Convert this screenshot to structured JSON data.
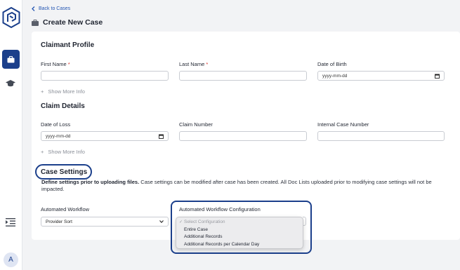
{
  "nav": {
    "back_label": "Back to Cases",
    "page_title": "Create New Case",
    "avatar_initial": "A"
  },
  "claimant": {
    "title": "Claimant Profile",
    "first_name_label": "First Name",
    "last_name_label": "Last Name",
    "dob_label": "Date of Birth",
    "dob_value": "yyyy-mm-dd",
    "required_mark": "*",
    "show_more": "Show More Info"
  },
  "claim": {
    "title": "Claim Details",
    "date_of_loss_label": "Date of Loss",
    "date_of_loss_value": "yyyy-mm-dd",
    "claim_number_label": "Claim Number",
    "internal_case_label": "Internal Case Number",
    "show_more": "Show More Info"
  },
  "settings": {
    "title": "Case Settings",
    "desc_bold": "Define settings prior to uploading files.",
    "desc_rest": " Case settings can be modified after case has been created. All Doc Lists uploaded prior to modifying case settings will not be impacted.",
    "workflow_label": "Automated Workflow",
    "workflow_value": "Provider Sort",
    "config_label": "Automated Workflow Configuration",
    "config_options": [
      "Select Configuration",
      "Entire Case",
      "Additional Records",
      "Additional Records per Calendar Day"
    ]
  },
  "colors": {
    "brand": "#1b3f8b",
    "link": "#2456b3",
    "required": "#d9342b"
  },
  "icons": [
    "logo-icon",
    "briefcase-icon",
    "graduation-cap-icon",
    "collapse-menu-icon",
    "chevron-left-icon",
    "calendar-icon",
    "plus-icon",
    "chevron-down-icon",
    "check-icon"
  ]
}
